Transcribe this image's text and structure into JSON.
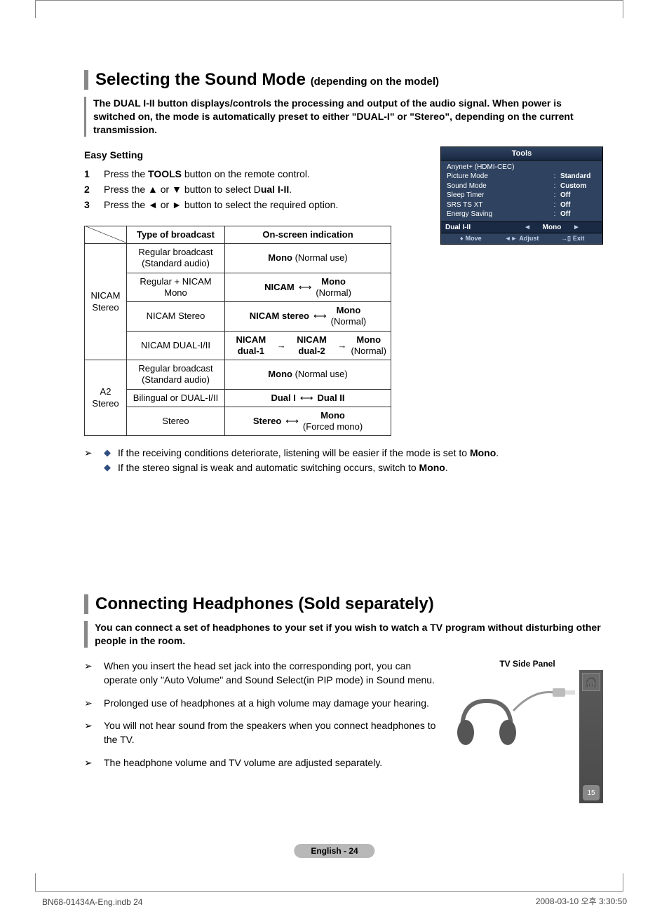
{
  "section1": {
    "title": "Selecting the Sound Mode",
    "title_sub": "(depending on the model)",
    "intro": "The DUAL I-II button displays/controls the processing and output of the audio signal. When power is switched on, the mode is automatically preset to either \"DUAL-I\" or \"Stereo\", depending on the current transmission.",
    "easy": "Easy Setting",
    "steps": [
      {
        "n": "1",
        "pre": "Press the ",
        "b": "TOOLS",
        "post": " button on the remote control."
      },
      {
        "n": "2",
        "pre": "Press the ▲ or ▼ button to select D",
        "b": "ual I-II",
        "post": "."
      },
      {
        "n": "3",
        "pre": "Press the ◄ or ► button to select the required option.",
        "b": "",
        "post": ""
      }
    ],
    "osd": {
      "title": "Tools",
      "items": [
        {
          "l": "Anynet+ (HDMI-CEC)",
          "r": ""
        },
        {
          "l": "Picture Mode",
          "r": "Standard"
        },
        {
          "l": "Sound Mode",
          "r": "Custom"
        },
        {
          "l": "Sleep Timer",
          "r": "Off"
        },
        {
          "l": "SRS TS XT",
          "r": "Off"
        },
        {
          "l": "Energy Saving",
          "r": "Off"
        }
      ],
      "sel_label": "Dual I-II",
      "sel_value": "Mono",
      "foot": {
        "move": "Move",
        "adjust": "Adjust",
        "exit": "Exit"
      }
    },
    "table": {
      "h1": "Type of broadcast",
      "h2": "On-screen indication",
      "g1": "NICAM Stereo",
      "g2": "A2 Stereo",
      "rows": {
        "r1_type": "Regular broadcast (Standard audio)",
        "r1_ind_b": "Mono",
        "r1_ind_n": " (Normal use)",
        "r2_type": "Regular + NICAM Mono",
        "r2_a": "NICAM",
        "r2_b": "Mono",
        "r2_bn": "(Normal)",
        "r3_type": "NICAM Stereo",
        "r3_a": "NICAM stereo",
        "r3_b": "Mono",
        "r3_bn": "(Normal)",
        "r4_type": "NICAM DUAL-I/II",
        "r4_a": "NICAM dual-1",
        "r4_b": "NICAM dual-2",
        "r4_c": "Mono",
        "r4_cn": "(Normal)",
        "r5_type": "Regular broadcast (Standard audio)",
        "r5_ind_b": "Mono",
        "r5_ind_n": " (Normal use)",
        "r6_type": "Bilingual or DUAL-I/II",
        "r6_a": "Dual I",
        "r6_b": "Dual II",
        "r7_type": "Stereo",
        "r7_a": "Stereo",
        "r7_b": "Mono",
        "r7_bn": "(Forced mono)"
      }
    },
    "notes": [
      "If the receiving conditions deteriorate, listening will be easier if the mode is set to ",
      "If the stereo signal is weak and automatic switching occurs, switch to "
    ],
    "notes_bold": "Mono"
  },
  "section2": {
    "title": "Connecting Headphones (Sold separately)",
    "intro": "You can connect a set of headphones to your set if you wish to watch a TV program without disturbing other people in the room.",
    "panel_label": "TV Side Panel",
    "page_badge": "15",
    "notes": [
      "When you insert the head set jack into the corresponding port, you can operate only \"Auto Volume\" and Sound Select(in PIP mode) in Sound menu.",
      "Prolonged use of headphones at a high volume may damage your hearing.",
      "You will not hear sound from the speakers when you connect headphones to the TV.",
      "The headphone volume and TV volume are adjusted separately."
    ]
  },
  "footer": {
    "pill": "English - 24",
    "left": "BN68-01434A-Eng.indb   24",
    "right": "2008-03-10   오후 3:30:50"
  }
}
